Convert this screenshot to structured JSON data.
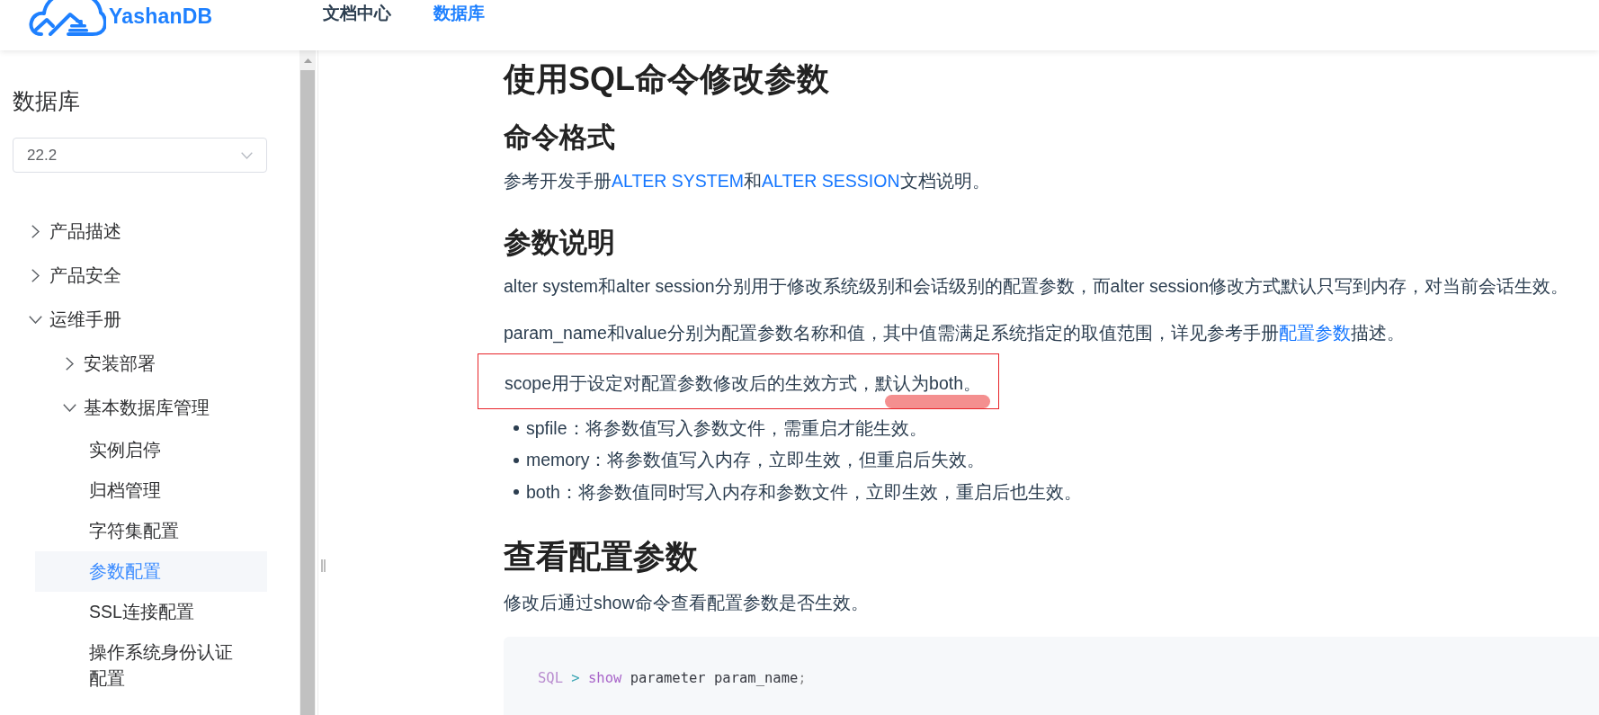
{
  "header": {
    "logo_text": "YashanDB",
    "nav": [
      {
        "label": "文档中心",
        "selected": false
      },
      {
        "label": "数据库",
        "selected": true
      }
    ]
  },
  "sidebar": {
    "title": "数据库",
    "version_select": {
      "value": "22.2"
    },
    "tree": [
      {
        "kind": "folder",
        "label": "产品描述",
        "expanded": false,
        "selected": false
      },
      {
        "kind": "folder",
        "label": "产品安全",
        "expanded": false,
        "selected": false
      },
      {
        "kind": "folder",
        "label": "运维手册",
        "expanded": true,
        "selected": false,
        "children": [
          {
            "kind": "folder",
            "label": "安装部署",
            "expanded": false,
            "selected": false
          },
          {
            "kind": "folder",
            "label": "基本数据库管理",
            "expanded": true,
            "selected": false,
            "children": [
              {
                "kind": "page",
                "label": "实例启停",
                "selected": false
              },
              {
                "kind": "page",
                "label": "归档管理",
                "selected": false
              },
              {
                "kind": "page",
                "label": "字符集配置",
                "selected": false
              },
              {
                "kind": "page",
                "label": "参数配置",
                "selected": true
              },
              {
                "kind": "page",
                "label": "SSL连接配置",
                "selected": false
              },
              {
                "kind": "page",
                "label": "操作系统身份认证配置",
                "selected": false
              }
            ]
          }
        ]
      }
    ]
  },
  "article": {
    "blocks": [
      {
        "kind": "h1",
        "text": "使用SQL命令修改参数"
      },
      {
        "kind": "h2",
        "text": "命令格式"
      },
      {
        "kind": "p",
        "parts": [
          {
            "kind": "text",
            "text": "参考开发手册"
          },
          {
            "kind": "link",
            "text": "ALTER SYSTEM"
          },
          {
            "kind": "text",
            "text": "和"
          },
          {
            "kind": "link",
            "text": "ALTER SESSION"
          },
          {
            "kind": "text",
            "text": "文档说明。"
          }
        ]
      },
      {
        "kind": "h2",
        "text": "参数说明"
      },
      {
        "kind": "p",
        "parts": [
          {
            "kind": "text",
            "text": "alter system和alter session分别用于修改系统级别和会话级别的配置参数，而alter session修改方式默认只写到内存，对当前会话生效。"
          }
        ]
      },
      {
        "kind": "p",
        "parts": [
          {
            "kind": "text",
            "text": "param_name和value分别为配置参数名称和值，其中值需满足系统指定的取值范围，详见参考手册"
          },
          {
            "kind": "link",
            "text": "配置参数"
          },
          {
            "kind": "text",
            "text": "描述。"
          }
        ]
      },
      {
        "kind": "p",
        "annotated": true,
        "parts": [
          {
            "kind": "text",
            "text": "scope用于设定对配置参数修改后的生效方式，默认为both。"
          }
        ]
      },
      {
        "kind": "ul",
        "items": [
          "spfile：将参数值写入参数文件，需重启才能生效。",
          "memory：将参数值写入内存，立即生效，但重启后失效。",
          "both：将参数值同时写入内存和参数文件，立即生效，重启后也生效。"
        ]
      },
      {
        "kind": "h1",
        "text": "查看配置参数"
      },
      {
        "kind": "p",
        "parts": [
          {
            "kind": "text",
            "text": "修改后通过show命令查看配置参数是否生效。"
          }
        ]
      },
      {
        "kind": "code",
        "tokens": [
          {
            "kind": "prompt",
            "text": "SQL"
          },
          {
            "kind": "operator",
            "text": " > "
          },
          {
            "kind": "keyword",
            "text": "show"
          },
          {
            "kind": "plain",
            "text": " parameter param_name"
          },
          {
            "kind": "punctuation",
            "text": ";"
          }
        ]
      }
    ]
  }
}
